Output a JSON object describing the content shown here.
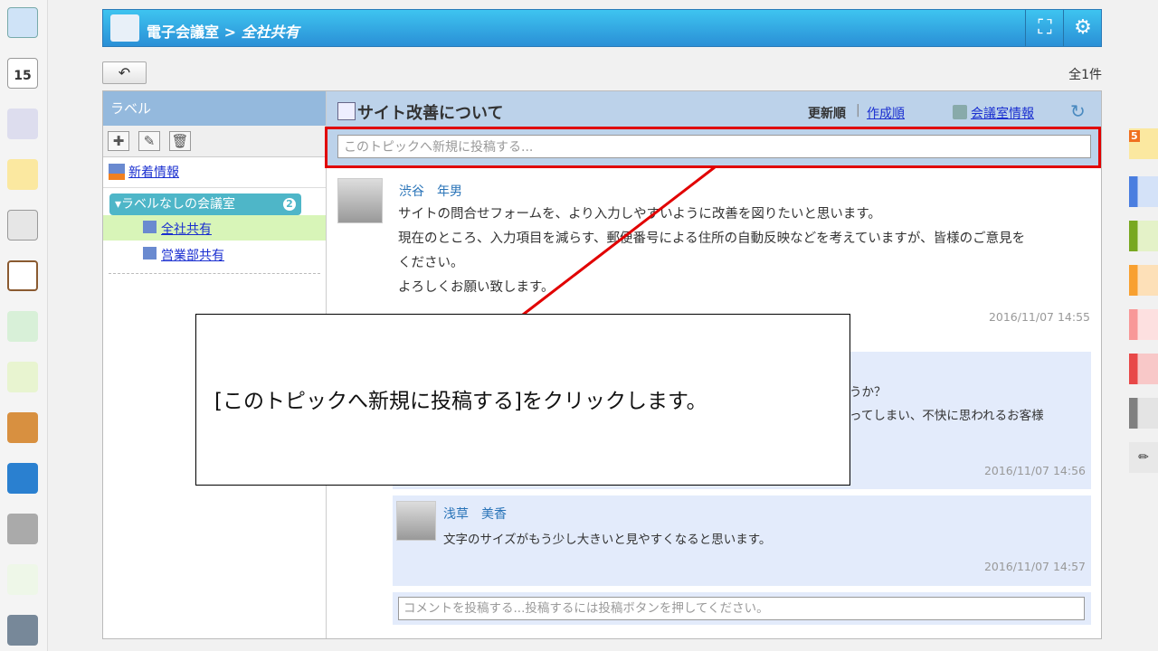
{
  "header": {
    "app": "電子会議室",
    "separator": ">",
    "room": "全社共有"
  },
  "back_icon": "undo-arrow-icon",
  "count": "全1件",
  "labels": {
    "title": "ラベル",
    "new_info": "新着情報",
    "group": "ラベルなしの会議室",
    "group_count": "2",
    "rooms": [
      "全社共有",
      "営業部共有"
    ]
  },
  "topic": {
    "title": "サイト改善について",
    "sort_update": "更新順",
    "sort_sep": "|",
    "sort_created": "作成順",
    "room_info": "会議室情報",
    "new_post_placeholder": "このトピックへ新規に投稿する..."
  },
  "post": {
    "author": "渋谷　年男",
    "lines": [
      "サイトの問合せフォームを、より入力しやすいように改善を図りたいと思います。",
      "現在のところ、入力項目を減らす、郵便番号による住所の自動反映などを考えていますが、皆様のご意見を",
      "ください。",
      "よろしくお願い致します。"
    ],
    "time": "2016/11/07 14:55"
  },
  "replies": [
    {
      "lines_visible": [
        "うか？",
        "ってしまい、不快に思われるお客様"
      ],
      "time": "2016/11/07 14:56"
    },
    {
      "author": "浅草　美香",
      "text": "文字のサイズがもう少し大きいと見やすくなると思います。",
      "time": "2016/11/07 14:57"
    }
  ],
  "comment_placeholder": "コメントを投稿する...投稿するには投稿ボタンを押してください。",
  "callout": "[このトピックへ新規に投稿する]をクリックします。",
  "colors": {
    "highlight": "#e10000",
    "header": "#2a8fd6",
    "reply_bg": "#e3ebfb"
  },
  "dock_badge": "15",
  "right_badge": "5"
}
